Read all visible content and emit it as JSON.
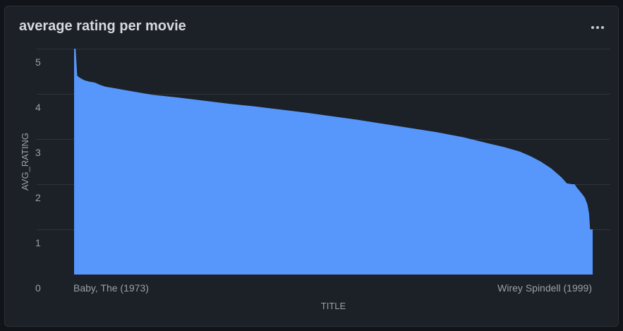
{
  "panel": {
    "title": "average rating per movie",
    "menu_icon": "more-horizontal-icon"
  },
  "chart_data": {
    "type": "area",
    "title": "average rating per movie",
    "xlabel": "TITLE",
    "ylabel": "AVG_RATING",
    "x_tick_labels": [
      "Baby, The (1973)",
      "Wirey Spindell (1999)"
    ],
    "y_ticks": [
      0,
      1,
      2,
      3,
      4,
      5
    ],
    "ylim": [
      0,
      5
    ],
    "grid": true,
    "color": "#5797fb",
    "series": [
      {
        "x": [
          0,
          0.003,
          0.006,
          0.012,
          0.02,
          0.03,
          0.04,
          0.05,
          0.06,
          0.08,
          0.1,
          0.15,
          0.2,
          0.25,
          0.3,
          0.35,
          0.4,
          0.45,
          0.5,
          0.55,
          0.6,
          0.65,
          0.7,
          0.75,
          0.8,
          0.83,
          0.86,
          0.88,
          0.9,
          0.92,
          0.94,
          0.95,
          0.96,
          0.965,
          0.97,
          0.975,
          0.98,
          0.985,
          0.99,
          0.993,
          0.995,
          1.0
        ],
        "values": [
          5.0,
          5.0,
          4.4,
          4.35,
          4.3,
          4.27,
          4.25,
          4.2,
          4.16,
          4.12,
          4.08,
          3.98,
          3.92,
          3.85,
          3.78,
          3.72,
          3.65,
          3.58,
          3.5,
          3.42,
          3.33,
          3.24,
          3.15,
          3.04,
          2.9,
          2.82,
          2.72,
          2.62,
          2.5,
          2.35,
          2.15,
          2.02,
          2.0,
          2.0,
          1.92,
          1.85,
          1.78,
          1.7,
          1.55,
          1.35,
          1.0,
          1.0
        ]
      }
    ]
  }
}
